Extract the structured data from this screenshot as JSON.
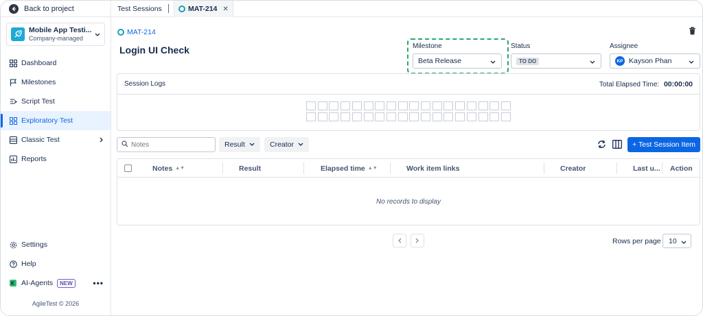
{
  "sidebar": {
    "back_label": "Back to project",
    "project": {
      "name": "Mobile App Testi...",
      "subtitle": "Company-managed"
    },
    "items": [
      {
        "label": "Dashboard",
        "icon": "dashboard-icon"
      },
      {
        "label": "Milestones",
        "icon": "flag-icon"
      },
      {
        "label": "Script Test",
        "icon": "script-icon"
      },
      {
        "label": "Exploratory Test",
        "icon": "grid-icon",
        "active": true
      },
      {
        "label": "Classic Test",
        "icon": "list-icon"
      },
      {
        "label": "Reports",
        "icon": "reports-icon"
      }
    ],
    "bottom": [
      {
        "label": "Settings",
        "icon": "gear-icon"
      },
      {
        "label": "Help",
        "icon": "help-icon"
      }
    ],
    "ai_agents": {
      "label": "AI-Agents",
      "badge": "NEW"
    },
    "footer": "AgileTest © 2026"
  },
  "tabs": [
    {
      "label": "Test Sessions"
    },
    {
      "label": "MAT-214",
      "active": true
    }
  ],
  "issue": {
    "key": "MAT-214",
    "title": "Login UI Check"
  },
  "fields": {
    "milestone": {
      "label": "Milestone",
      "value": "Beta Release"
    },
    "status": {
      "label": "Status",
      "value": "TO DO"
    },
    "assignee": {
      "label": "Assignee",
      "value": "Kayson Phan",
      "initials": "KP"
    }
  },
  "session_logs": {
    "title": "Session Logs",
    "elapsed_label": "Total Elapsed Time:",
    "elapsed_value": "00:00:00"
  },
  "toolbar": {
    "search_placeholder": "Notes",
    "result_filter": "Result",
    "creator_filter": "Creator",
    "add_button": "+ Test Session Item"
  },
  "table": {
    "columns": [
      "Notes",
      "Result",
      "Elapsed time",
      "Work item links",
      "Creator",
      "Last u...",
      "Action"
    ],
    "empty_message": "No records to display"
  },
  "pagination": {
    "rows_label": "Rows per page",
    "rows_value": "10"
  },
  "colors": {
    "primary": "#0c66e4",
    "highlight": "#27a86b"
  }
}
